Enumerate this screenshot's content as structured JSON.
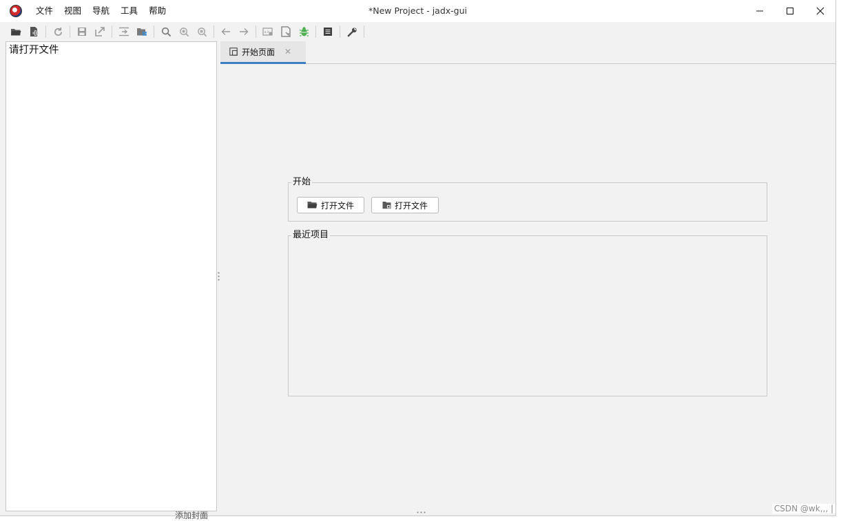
{
  "window": {
    "title": "*New Project - jadx-gui",
    "logo_icon": "jadx-logo-icon",
    "controls": [
      "minimize-icon",
      "maximize-icon",
      "close-icon"
    ]
  },
  "menubar": {
    "items": [
      {
        "label": "文件"
      },
      {
        "label": "视图"
      },
      {
        "label": "导航"
      },
      {
        "label": "工具"
      },
      {
        "label": "帮助"
      }
    ]
  },
  "toolbar": {
    "icons": [
      "open-folder-icon",
      "add-files-icon",
      "reload-icon",
      "save-icon",
      "export-icon",
      "sync-icon",
      "flatten-packages-icon",
      "search-icon",
      "find-class-icon",
      "find-usage-icon",
      "back-arrow-icon",
      "forward-arrow-icon",
      "deobfuscation-icon",
      "quick-tab-icon",
      "debugger-bug-icon",
      "log-viewer-icon",
      "preferences-wrench-icon"
    ],
    "accent_debug": "#4caf50"
  },
  "left_panel": {
    "hint": "请打开文件"
  },
  "tabs": [
    {
      "label": "开始页面",
      "icon": "start-page-icon",
      "active": true
    }
  ],
  "start_group": {
    "title": "开始",
    "buttons": [
      {
        "label": "打开文件",
        "icon": "open-folder-icon"
      },
      {
        "label": "打开文件",
        "icon": "open-project-icon"
      }
    ]
  },
  "recent_group": {
    "title": "最近项目",
    "items": []
  },
  "background": {
    "partial_text": "添加封面"
  },
  "watermark": "CSDN @wk,,, |",
  "colors": {
    "tab_accent": "#3d7fc6",
    "panel_bg": "#f2f2f2"
  }
}
